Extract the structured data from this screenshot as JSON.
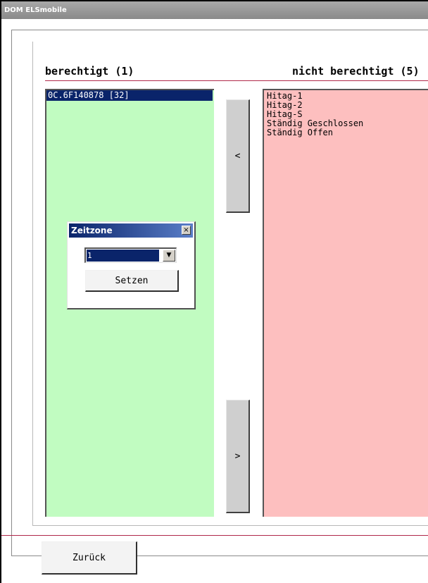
{
  "window": {
    "title": "DOM ELSmobile"
  },
  "headers": {
    "left": "berechtigt (1)",
    "right": "nicht berechtigt (5)"
  },
  "left_list": {
    "items": [
      "0C.6F140878 [32]"
    ],
    "selected_index": 0
  },
  "right_list": {
    "items": [
      "Hitag-1",
      "Hitag-2",
      "Hitag-S",
      "Ständig Geschlossen",
      "Ständig Offen"
    ]
  },
  "buttons": {
    "move_left": "<",
    "move_right": ">",
    "back": "Zurück"
  },
  "dialog": {
    "title": "Zeitzone",
    "close_glyph": "×",
    "select_value": "1",
    "select_arrow": "▼",
    "set_button": "Setzen"
  },
  "colors": {
    "allowed_list_bg": "#c1fcc1",
    "denied_list_bg": "#fdbfbf",
    "selection": "#0a246a",
    "divider": "#b0284a"
  }
}
